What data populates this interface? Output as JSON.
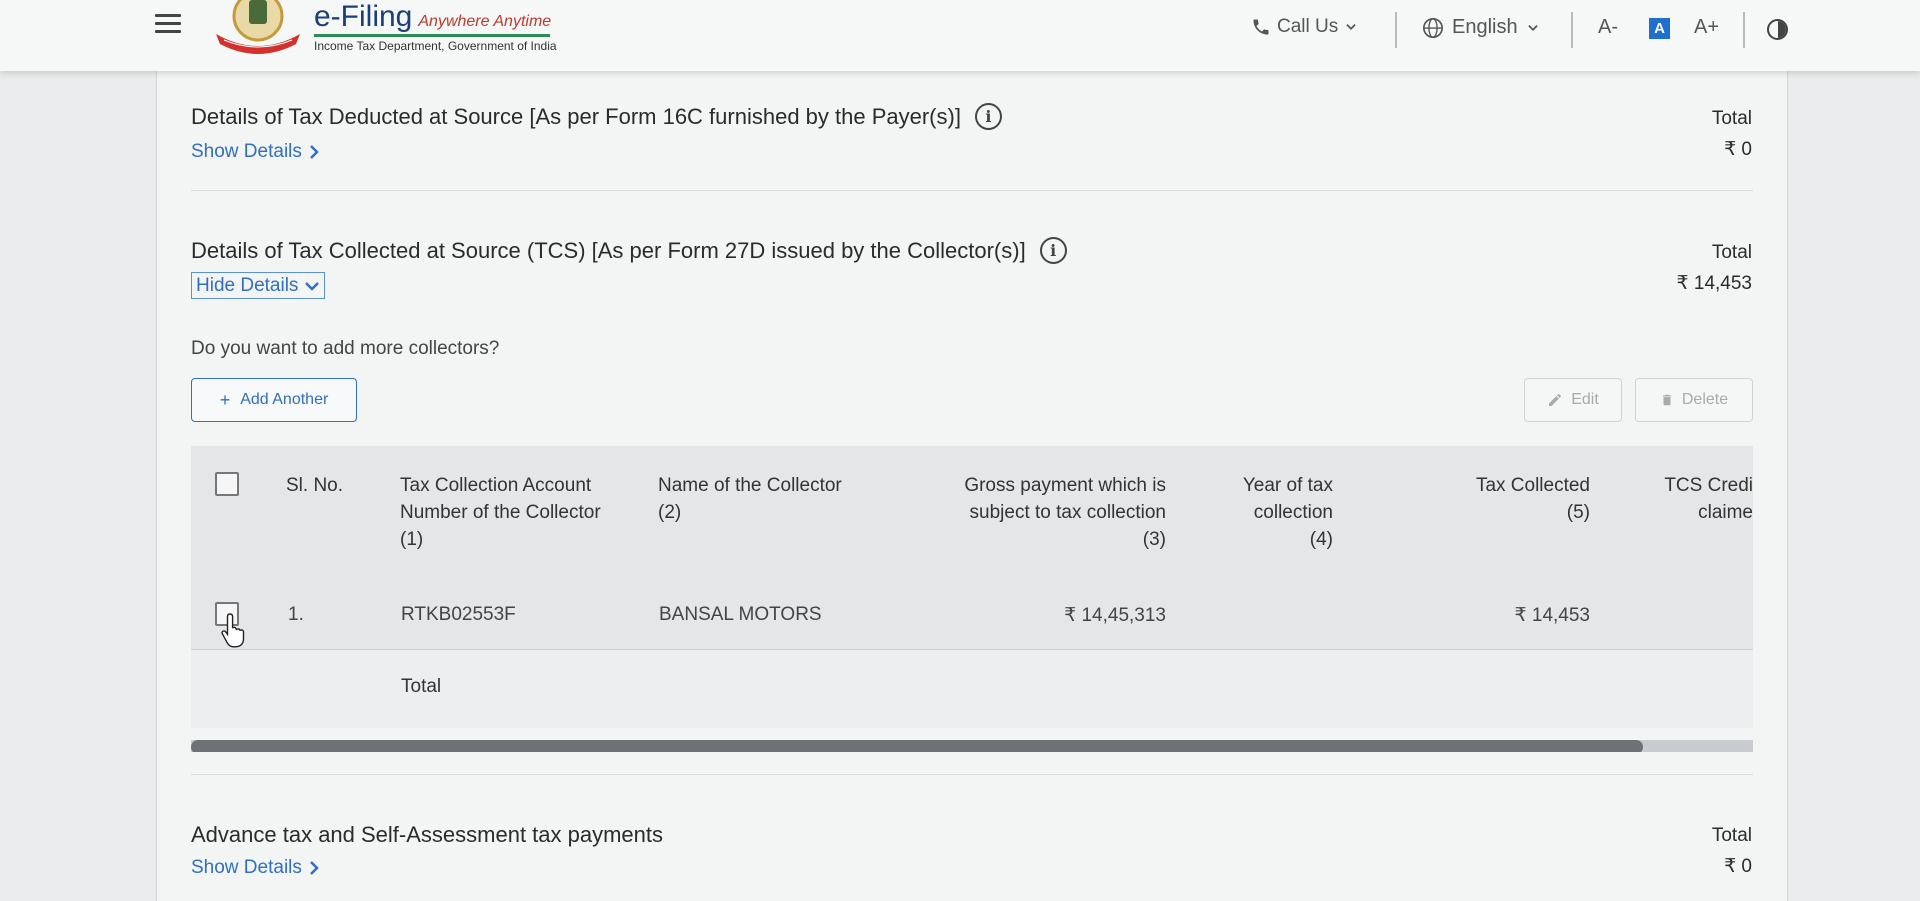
{
  "header": {
    "brand_title": "e-Filing",
    "brand_tagline": "Anywhere Anytime",
    "brand_subtitle": "Income Tax Department, Government of India",
    "call_us": "Call Us",
    "language": "English",
    "font_decrease": "A-",
    "font_normal": "A",
    "font_increase": "A+"
  },
  "tds_section": {
    "title": "Details of Tax Deducted at Source [As per Form 16C furnished by the Payer(s)]",
    "toggle_label": "Show Details",
    "total_label": "Total",
    "total_value": "₹ 0"
  },
  "tcs_section": {
    "title": "Details of Tax Collected at Source (TCS) [As per Form 27D issued by the Collector(s)]",
    "toggle_label": "Hide Details",
    "total_label": "Total",
    "total_value": "₹ 14,453",
    "question": "Do you want to add more collectors?",
    "add_button": "Add Another",
    "edit_button": "Edit",
    "delete_button": "Delete",
    "columns": [
      [
        "Sl. No."
      ],
      [
        "Tax Collection Account",
        "Number of the Collector",
        "(1)"
      ],
      [
        "Name of the Collector",
        "(2)"
      ],
      [
        "Gross payment which is",
        "subject to tax collection",
        "(3)"
      ],
      [
        "Year of tax",
        "collection",
        "(4)"
      ],
      [
        "Tax Collected",
        "(5)"
      ],
      [
        "TCS Credi",
        "claime"
      ]
    ],
    "rows": [
      {
        "sl": "1.",
        "tan": "RTKB02553F",
        "name": "BANSAL MOTORS",
        "gross": "₹ 14,45,313",
        "year": "",
        "collected": "₹ 14,453"
      }
    ],
    "total_row_label": "Total"
  },
  "advance_section": {
    "title": "Advance tax and Self-Assessment tax payments",
    "toggle_label": "Show Details",
    "total_label": "Total",
    "total_value": "₹ 0"
  },
  "colors": {
    "brand_blue": "#1a3f7a",
    "link_blue": "#2f6fc4",
    "accent_blue": "#1f6fcf"
  }
}
